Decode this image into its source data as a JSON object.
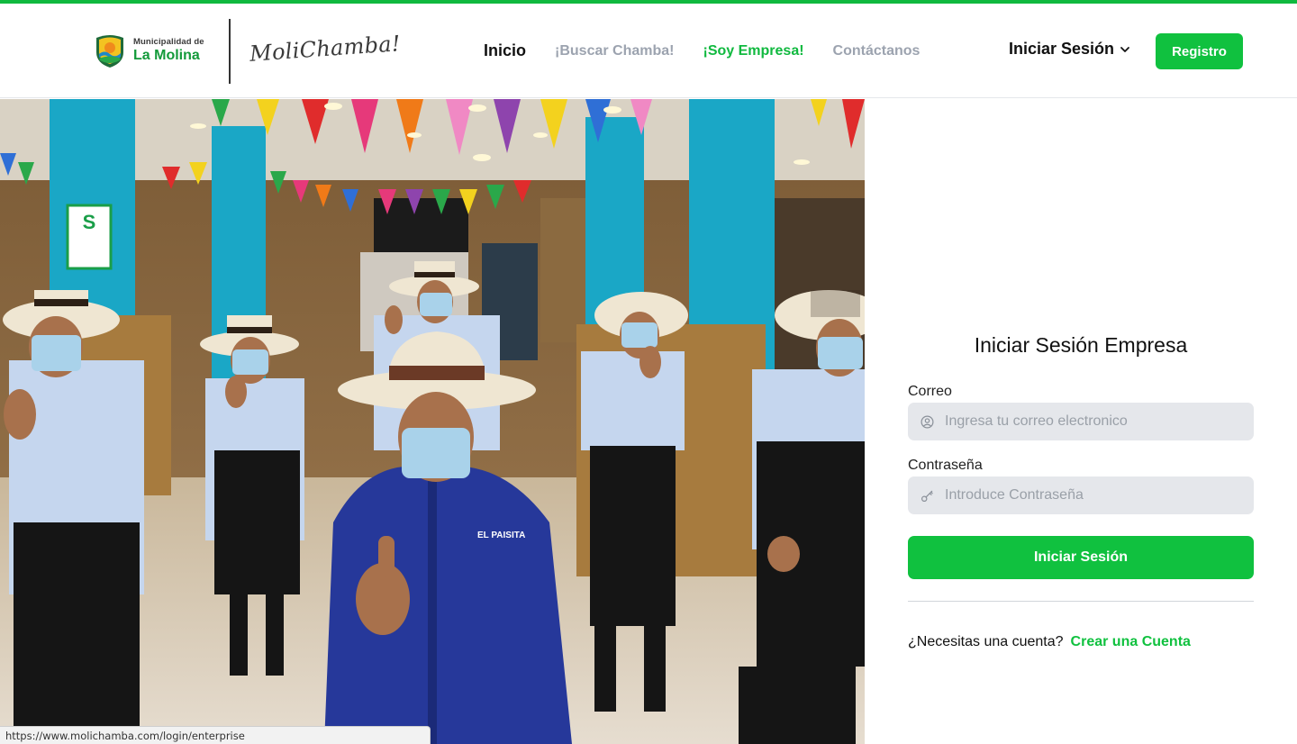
{
  "header": {
    "logo": {
      "line1": "Municipalidad de",
      "line2": "La Molina"
    },
    "brand": "MoliChamba!",
    "nav": [
      {
        "label": "Inicio",
        "state": "active"
      },
      {
        "label": "¡Buscar Chamba!",
        "state": "muted"
      },
      {
        "label": "¡Soy Empresa!",
        "state": "green"
      },
      {
        "label": "Contáctanos",
        "state": "muted"
      }
    ],
    "login_menu": "Iniciar Sesión",
    "register_button": "Registro"
  },
  "form": {
    "title": "Iniciar Sesión Empresa",
    "email_label": "Correo",
    "email_placeholder": "Ingresa tu correo electronico",
    "password_label": "Contraseña",
    "password_placeholder": "Introduce Contraseña",
    "submit": "Iniciar Sesión",
    "need_account": "¿Necesitas una cuenta?",
    "create_account": "Crear una Cuenta"
  },
  "status_bar_url": "https://www.molichamba.com/login/enterprise",
  "colors": {
    "accent": "#10c13f",
    "top_bar": "#10b93f",
    "muted": "#9ca3af"
  },
  "icons": [
    "user-circle-icon",
    "key-icon",
    "chevron-down-icon"
  ]
}
